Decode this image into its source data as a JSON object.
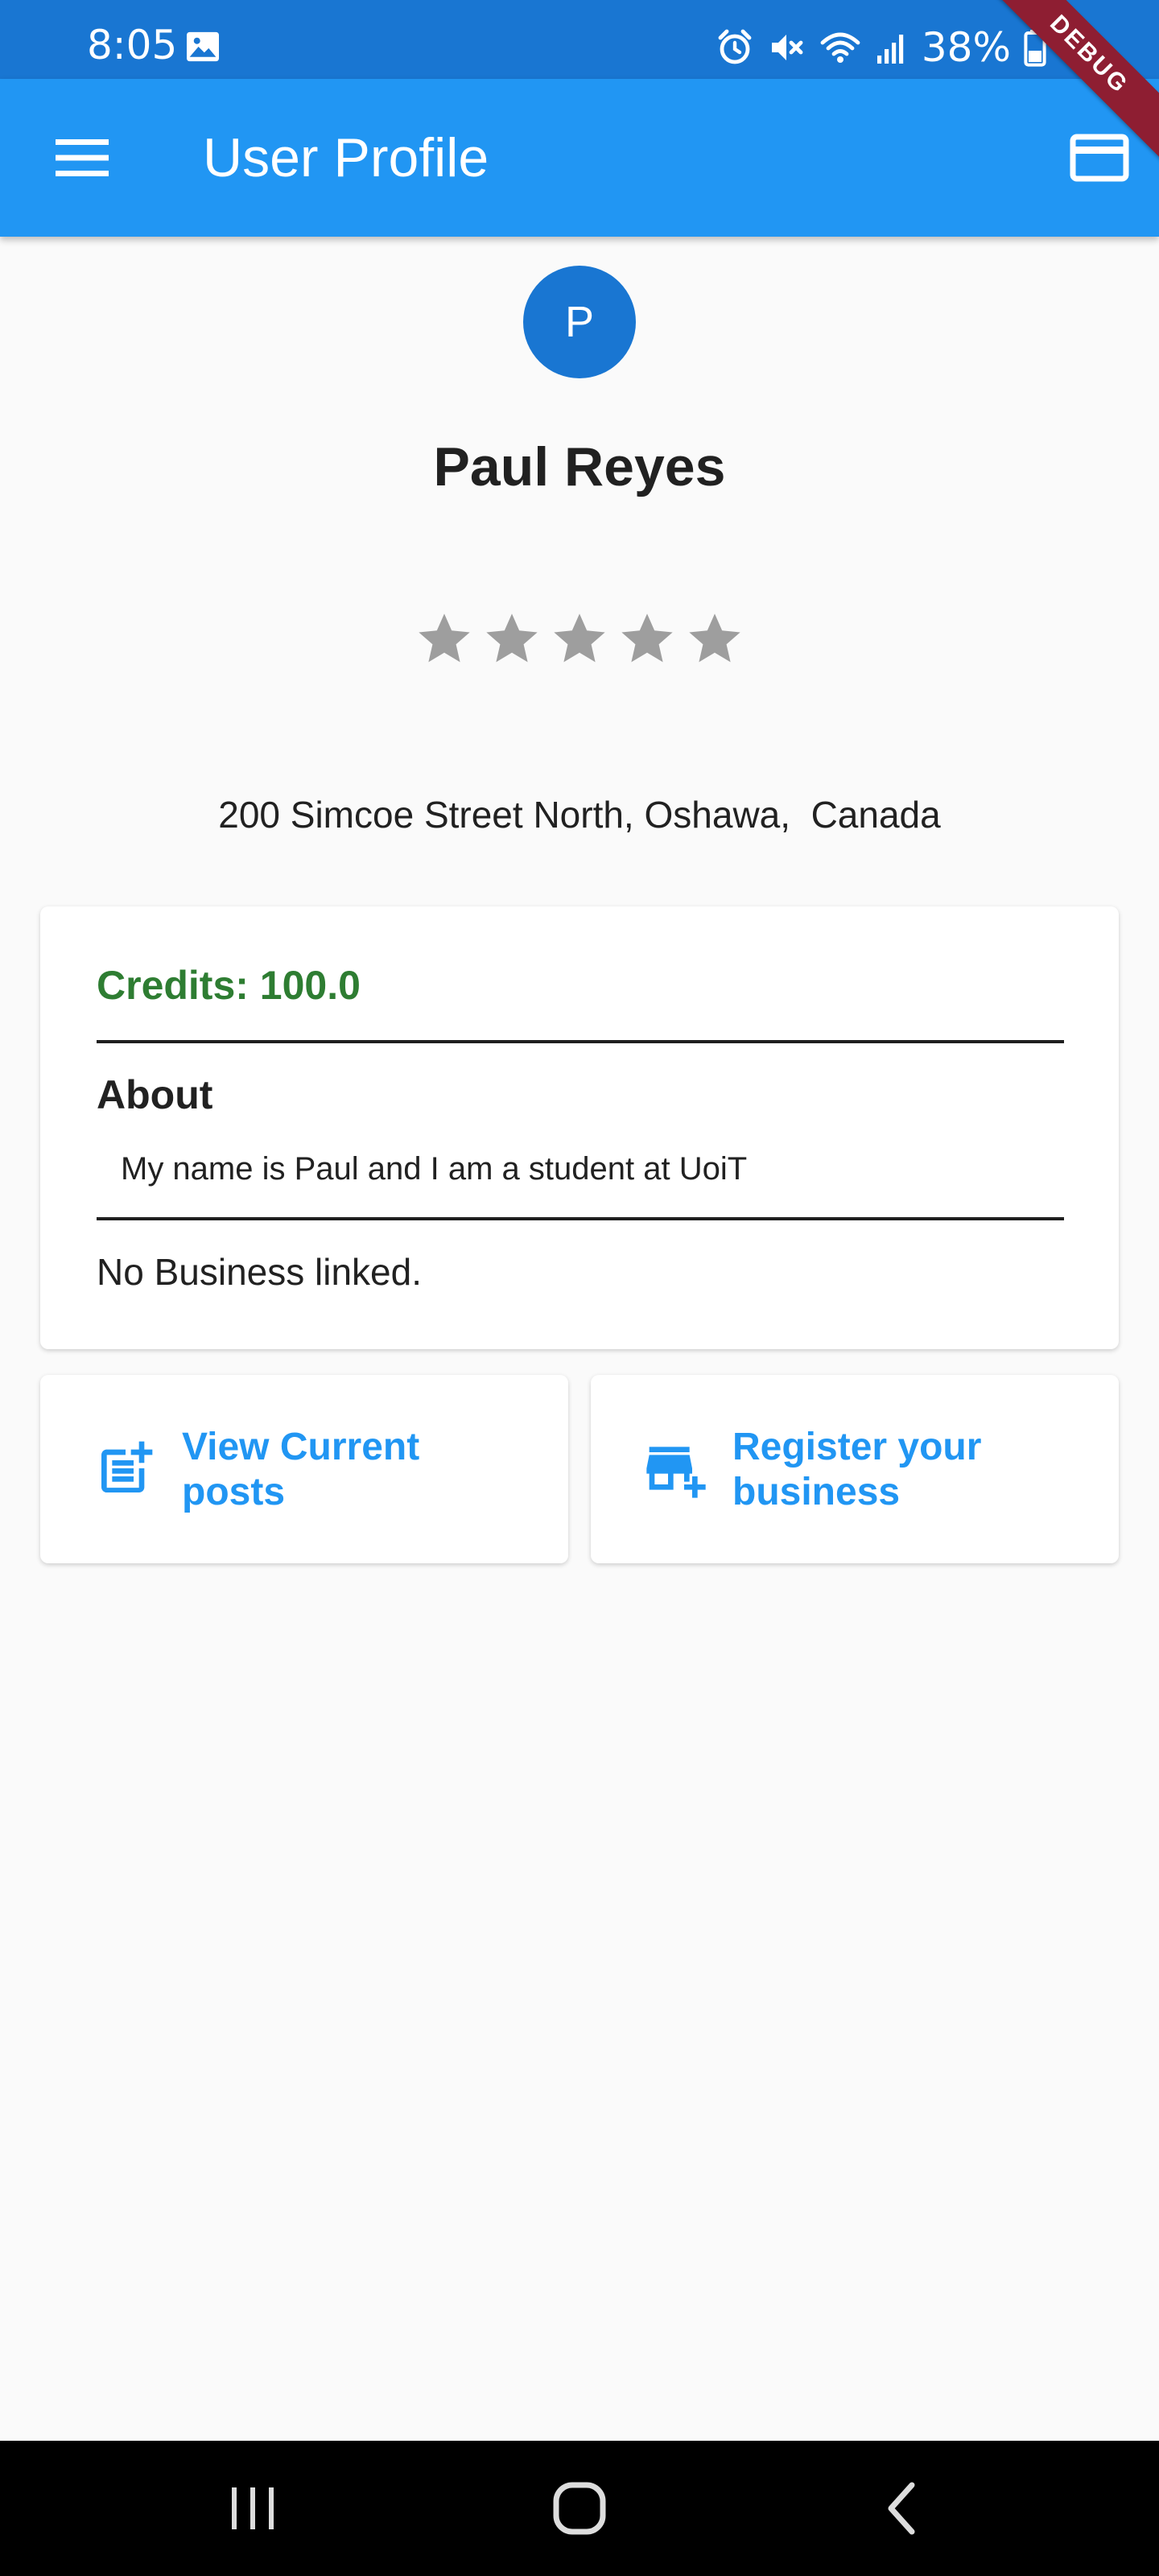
{
  "status_bar": {
    "time": "8:05",
    "battery": "38%",
    "icons": [
      "image-icon",
      "alarm-icon",
      "mute-icon",
      "wifi-icon",
      "signal-icon",
      "battery-icon"
    ]
  },
  "debug_banner": {
    "label": "DEBUG",
    "color": "#8E1E32"
  },
  "app_bar": {
    "title": "User Profile",
    "leading_icon": "menu-icon",
    "trailing_icon": "credit-card-icon",
    "color": "#2196F3"
  },
  "profile": {
    "avatar_initial": "P",
    "avatar_color": "#1976D2",
    "name": "Paul Reyes",
    "rating": {
      "value": 0,
      "max": 5
    },
    "address": "200 Simcoe Street North, Oshawa,  Canada"
  },
  "info_card": {
    "credits": "Credits: 100.0",
    "credits_color": "#2E7D32",
    "about_title": "About",
    "about_text": "My name is Paul and I am a student at UoiT",
    "business_status": "No Business linked."
  },
  "actions": [
    {
      "label": "View Current posts",
      "icon": "post-add-icon"
    },
    {
      "label": "Register your business",
      "icon": "add-business-icon"
    }
  ],
  "nav_bar": {
    "buttons": [
      "recents-icon",
      "home-icon",
      "back-icon"
    ]
  }
}
